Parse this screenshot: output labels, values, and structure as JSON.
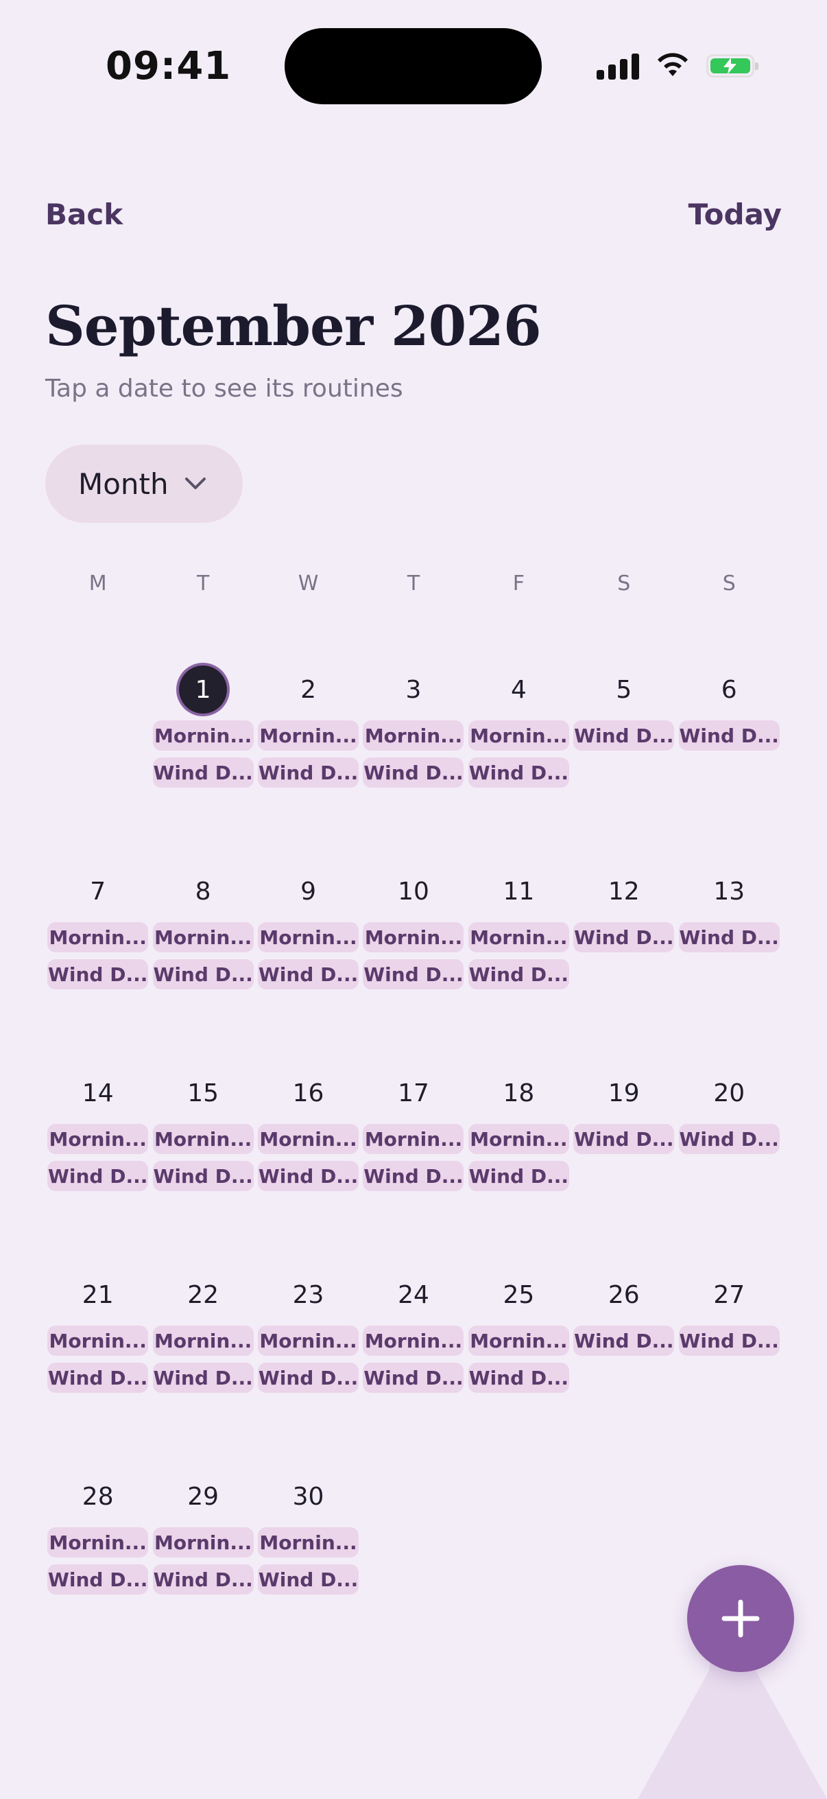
{
  "status": {
    "time": "09:41"
  },
  "nav": {
    "back": "Back",
    "today": "Today"
  },
  "header": {
    "title": "September 2026",
    "subtitle": "Tap a date to see its routines"
  },
  "view": {
    "selected": "Month"
  },
  "weekdays": [
    "M",
    "T",
    "W",
    "T",
    "F",
    "S",
    "S"
  ],
  "weeks": [
    [
      {
        "day": "",
        "chips": []
      },
      {
        "day": "1",
        "selected": true,
        "chips": [
          "Mornin...",
          "Wind D..."
        ]
      },
      {
        "day": "2",
        "chips": [
          "Mornin...",
          "Wind D..."
        ]
      },
      {
        "day": "3",
        "chips": [
          "Mornin...",
          "Wind D..."
        ]
      },
      {
        "day": "4",
        "chips": [
          "Mornin...",
          "Wind D..."
        ]
      },
      {
        "day": "5",
        "chips": [
          "Wind D..."
        ]
      },
      {
        "day": "6",
        "chips": [
          "Wind D..."
        ]
      }
    ],
    [
      {
        "day": "7",
        "chips": [
          "Mornin...",
          "Wind D..."
        ]
      },
      {
        "day": "8",
        "chips": [
          "Mornin...",
          "Wind D..."
        ]
      },
      {
        "day": "9",
        "chips": [
          "Mornin...",
          "Wind D..."
        ]
      },
      {
        "day": "10",
        "chips": [
          "Mornin...",
          "Wind D..."
        ]
      },
      {
        "day": "11",
        "chips": [
          "Mornin...",
          "Wind D..."
        ]
      },
      {
        "day": "12",
        "chips": [
          "Wind D..."
        ]
      },
      {
        "day": "13",
        "chips": [
          "Wind D..."
        ]
      }
    ],
    [
      {
        "day": "14",
        "chips": [
          "Mornin...",
          "Wind D..."
        ]
      },
      {
        "day": "15",
        "chips": [
          "Mornin...",
          "Wind D..."
        ]
      },
      {
        "day": "16",
        "chips": [
          "Mornin...",
          "Wind D..."
        ]
      },
      {
        "day": "17",
        "chips": [
          "Mornin...",
          "Wind D..."
        ]
      },
      {
        "day": "18",
        "chips": [
          "Mornin...",
          "Wind D..."
        ]
      },
      {
        "day": "19",
        "chips": [
          "Wind D..."
        ]
      },
      {
        "day": "20",
        "chips": [
          "Wind D..."
        ]
      }
    ],
    [
      {
        "day": "21",
        "chips": [
          "Mornin...",
          "Wind D..."
        ]
      },
      {
        "day": "22",
        "chips": [
          "Mornin...",
          "Wind D..."
        ]
      },
      {
        "day": "23",
        "chips": [
          "Mornin...",
          "Wind D..."
        ]
      },
      {
        "day": "24",
        "chips": [
          "Mornin...",
          "Wind D..."
        ]
      },
      {
        "day": "25",
        "chips": [
          "Mornin...",
          "Wind D..."
        ]
      },
      {
        "day": "26",
        "chips": [
          "Wind D..."
        ]
      },
      {
        "day": "27",
        "chips": [
          "Wind D..."
        ]
      }
    ],
    [
      {
        "day": "28",
        "chips": [
          "Mornin...",
          "Wind D..."
        ]
      },
      {
        "day": "29",
        "chips": [
          "Mornin...",
          "Wind D..."
        ]
      },
      {
        "day": "30",
        "chips": [
          "Mornin...",
          "Wind D..."
        ]
      },
      {
        "day": "",
        "chips": []
      },
      {
        "day": "",
        "chips": []
      },
      {
        "day": "",
        "chips": []
      },
      {
        "day": "",
        "chips": []
      }
    ]
  ],
  "fab": {
    "icon": "plus-icon"
  },
  "colors": {
    "accent": "#8a5ca3",
    "background": "#f3edf7",
    "chip": "#ebd5ea",
    "chip_text": "#5a3a6b",
    "selected_day": "#23202d"
  }
}
